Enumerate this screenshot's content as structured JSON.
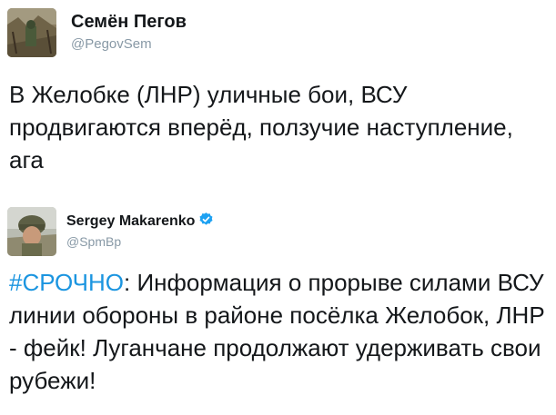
{
  "tweets": [
    {
      "author_name": "Семён Пегов",
      "handle": "@PegovSem",
      "verified": false,
      "text": "В Желобке (ЛНР) уличные бои, ВСУ продвигаются вперёд, ползучие наступление, ага"
    },
    {
      "author_name": "Sergey Makarenko",
      "handle": "@SpmBp",
      "verified": true,
      "hashtag": "#СРОЧНО",
      "text": ": Информация о прорыве силами ВСУ линии обороны в районе посёлка Желобок, ЛНР - фейк! Луганчане продолжают удерживать свои рубежи!"
    }
  ],
  "colors": {
    "hashtag": "#1b95e0",
    "handle": "#8899a6",
    "verified_badge": "#1da1f2",
    "text": "#14171a"
  },
  "icons": {
    "verified": "verified-badge-icon"
  }
}
